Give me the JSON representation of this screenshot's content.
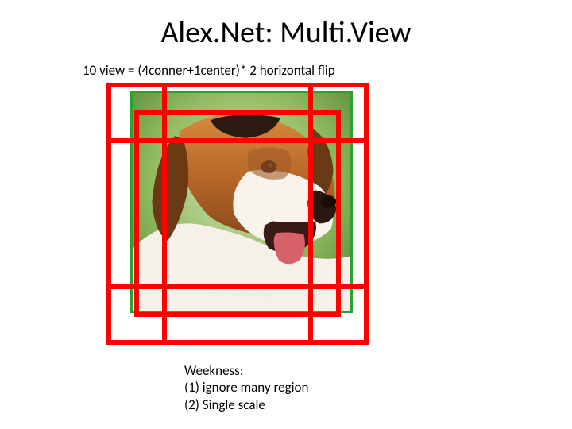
{
  "title": "Alex.Net: Multi.View",
  "subtitle": "10 view = (4conner+1center)* 2 horizontal flip",
  "weakness": {
    "heading": "Weekness:",
    "line1": "(1) ignore many region",
    "line2": "(2) Single scale"
  },
  "image": {
    "watermark": "©2010 carousel image",
    "border_color": "#2fa02f",
    "crop_color": "#ff0000",
    "crops": [
      "top-left",
      "top-right",
      "bottom-left",
      "bottom-right",
      "center"
    ]
  }
}
